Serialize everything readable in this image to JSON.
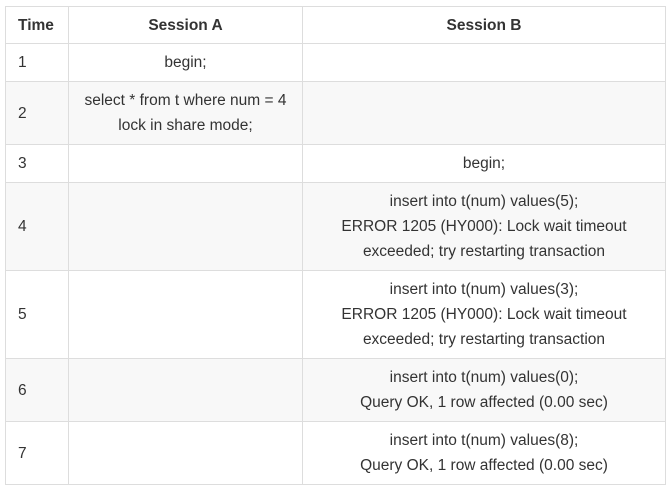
{
  "header": {
    "time": "Time",
    "session_a": "Session A",
    "session_b": "Session B"
  },
  "rows": [
    {
      "time": "1",
      "session_a": [
        "begin;"
      ],
      "session_b": []
    },
    {
      "time": "2",
      "session_a": [
        "select * from t where num = 4",
        "lock in share mode;"
      ],
      "session_b": []
    },
    {
      "time": "3",
      "session_a": [],
      "session_b": [
        "begin;"
      ]
    },
    {
      "time": "4",
      "session_a": [],
      "session_b": [
        "insert into t(num) values(5);",
        "ERROR 1205 (HY000): Lock wait timeout",
        "exceeded; try restarting transaction"
      ]
    },
    {
      "time": "5",
      "session_a": [],
      "session_b": [
        "insert into t(num) values(3);",
        "ERROR 1205 (HY000): Lock wait timeout",
        "exceeded; try restarting transaction"
      ]
    },
    {
      "time": "6",
      "session_a": [],
      "session_b": [
        "insert into t(num) values(0);",
        "Query OK, 1 row affected (0.00 sec)"
      ]
    },
    {
      "time": "7",
      "session_a": [],
      "session_b": [
        "insert into t(num) values(8);",
        "Query OK, 1 row affected (0.00 sec)"
      ]
    }
  ]
}
